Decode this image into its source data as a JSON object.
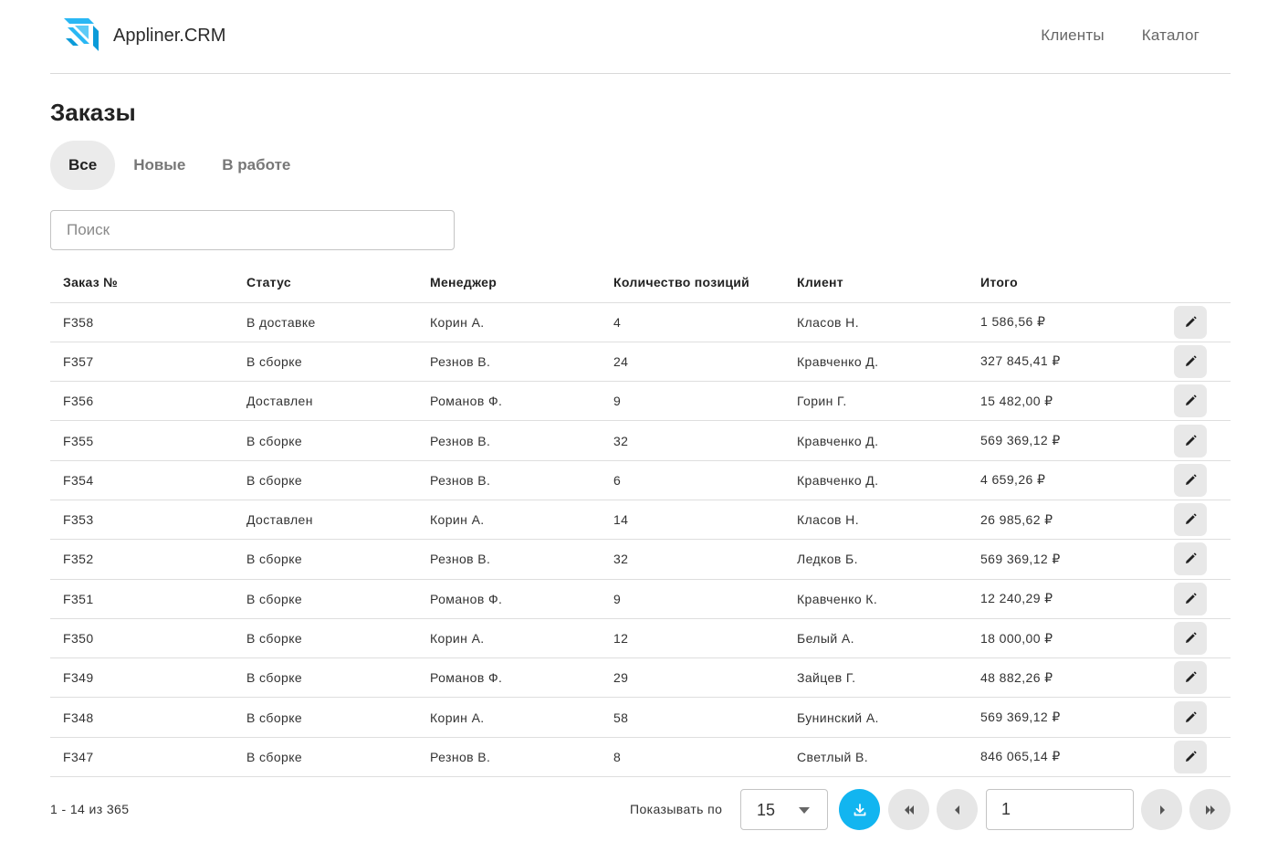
{
  "app": {
    "brand": "Appliner.CRM"
  },
  "nav": [
    {
      "label": "Клиенты"
    },
    {
      "label": "Каталог"
    }
  ],
  "page": {
    "title": "Заказы"
  },
  "tabs": [
    {
      "label": "Все",
      "active": true
    },
    {
      "label": "Новые",
      "active": false
    },
    {
      "label": "В работе",
      "active": false
    }
  ],
  "search": {
    "placeholder": "Поиск",
    "value": ""
  },
  "table": {
    "columns": [
      "Заказ №",
      "Статус",
      "Менеджер",
      "Количество позиций",
      "Клиент",
      "Итого"
    ],
    "rows": [
      [
        "F358",
        "В доставке",
        "Корин А.",
        "4",
        "Класов Н.",
        "1 586,56 ₽"
      ],
      [
        "F357",
        "В сборке",
        "Резнов В.",
        "24",
        "Кравченко Д.",
        "327 845,41 ₽"
      ],
      [
        "F356",
        "Доставлен",
        "Романов Ф.",
        "9",
        "Горин Г.",
        "15 482,00 ₽"
      ],
      [
        "F355",
        "В сборке",
        "Резнов В.",
        "32",
        "Кравченко Д.",
        "569 369,12 ₽"
      ],
      [
        "F354",
        "В сборке",
        "Резнов В.",
        "6",
        "Кравченко Д.",
        "4 659,26 ₽"
      ],
      [
        "F353",
        "Доставлен",
        "Корин А.",
        "14",
        "Класов Н.",
        "26 985,62 ₽"
      ],
      [
        "F352",
        "В сборке",
        "Резнов В.",
        "32",
        "Ледков Б.",
        "569 369,12 ₽"
      ],
      [
        "F351",
        "В сборке",
        "Романов Ф.",
        "9",
        "Кравченко К.",
        "12 240,29 ₽"
      ],
      [
        "F350",
        "В сборке",
        "Корин А.",
        "12",
        "Белый А.",
        "18 000,00 ₽"
      ],
      [
        "F349",
        "В сборке",
        "Романов Ф.",
        "29",
        "Зайцев Г.",
        "48 882,26 ₽"
      ],
      [
        "F348",
        "В сборке",
        "Корин А.",
        "58",
        "Бунинский А.",
        "569 369,12 ₽"
      ],
      [
        "F347",
        "В сборке",
        "Резнов В.",
        "8",
        "Светлый В.",
        "846 065,14 ₽"
      ]
    ]
  },
  "footer": {
    "range": "1 - 14 из 365",
    "per_page_label": "Показывать по",
    "per_page_value": "15",
    "page_value": "1"
  },
  "colors": {
    "accent": "#12b5f0",
    "tab_active_bg": "#ebebeb",
    "button_bg": "#e8e8e8",
    "divider": "#dedede"
  },
  "icons": {
    "logo": "appliner-logo",
    "edit": "pencil-icon",
    "download": "download-icon",
    "first": "double-chevron-left-icon",
    "prev": "chevron-left-icon",
    "next": "chevron-right-icon",
    "last": "double-chevron-right-icon",
    "caret": "caret-down-icon"
  }
}
